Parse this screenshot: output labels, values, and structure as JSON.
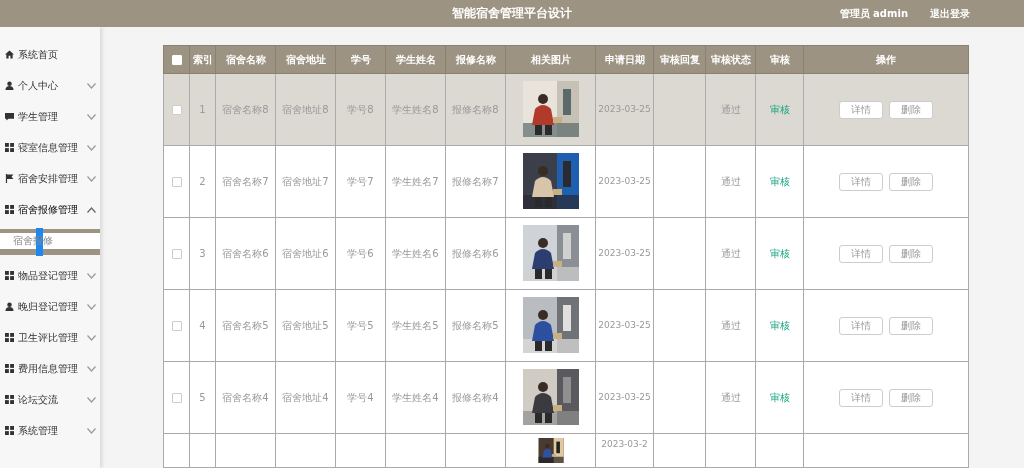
{
  "header": {
    "title": "智能宿舍管理平台设计",
    "user": "管理员 admin",
    "logout": "退出登录"
  },
  "sidebar": {
    "items": [
      {
        "label": "系统首页"
      },
      {
        "label": "个人中心",
        "expanded": false
      },
      {
        "label": "学生管理",
        "expanded": false
      },
      {
        "label": "寝室信息管理",
        "expanded": false
      },
      {
        "label": "宿舍安排管理",
        "expanded": false
      },
      {
        "label": "宿舍报修管理",
        "expanded": true,
        "children": [
          {
            "label": "宿舍报修",
            "selected": true
          }
        ]
      },
      {
        "label": "物品登记管理",
        "expanded": false
      },
      {
        "label": "晚归登记管理",
        "expanded": false
      },
      {
        "label": "卫生评比管理",
        "expanded": false
      },
      {
        "label": "费用信息管理",
        "expanded": false
      },
      {
        "label": "论坛交流",
        "expanded": false
      },
      {
        "label": "系统管理",
        "expanded": false
      }
    ]
  },
  "table": {
    "select_all_checked": false,
    "columns": [
      "索引",
      "宿舍名称",
      "宿舍地址",
      "学号",
      "学生姓名",
      "报修名称",
      "相关图片",
      "申请日期",
      "审核回复",
      "审核状态",
      "审核",
      "操作"
    ],
    "rows": [
      {
        "kind": "full",
        "highlighted": true,
        "checked": false,
        "index": "1",
        "dorm_name": "宿舍名称8",
        "dorm_address": "宿舍地址8",
        "student_id": "学号8",
        "student_name": "学生姓名8",
        "repair_name": "报修名称8",
        "date": "2023-03-25",
        "status": "通过",
        "review": "审核",
        "actions": [
          "详情",
          "删除"
        ]
      },
      {
        "kind": "full",
        "highlighted": false,
        "checked": false,
        "index": "2",
        "dorm_name": "宿舍名称7",
        "dorm_address": "宿舍地址7",
        "student_id": "学号7",
        "student_name": "学生姓名7",
        "repair_name": "报修名称7",
        "date": "2023-03-25",
        "status": "通过",
        "review": "审核",
        "actions": [
          "详情",
          "删除"
        ]
      },
      {
        "kind": "full",
        "highlighted": false,
        "checked": false,
        "index": "3",
        "dorm_name": "宿舍名称6",
        "dorm_address": "宿舍地址6",
        "student_id": "学号6",
        "student_name": "学生姓名6",
        "repair_name": "报修名称6",
        "date": "2023-03-25",
        "status": "通过",
        "review": "审核",
        "actions": [
          "详情",
          "删除"
        ]
      },
      {
        "kind": "full",
        "highlighted": false,
        "checked": false,
        "index": "4",
        "dorm_name": "宿舍名称5",
        "dorm_address": "宿舍地址5",
        "student_id": "学号5",
        "student_name": "学生姓名5",
        "repair_name": "报修名称5",
        "date": "2023-03-25",
        "status": "通过",
        "review": "审核",
        "actions": [
          "详情",
          "删除"
        ]
      },
      {
        "kind": "full",
        "highlighted": false,
        "checked": false,
        "index": "5",
        "dorm_name": "宿舍名称4",
        "dorm_address": "宿舍地址4",
        "student_id": "学号4",
        "student_name": "学生姓名4",
        "repair_name": "报修名称4",
        "date": "2023-03-25",
        "status": "通过",
        "review": "审核",
        "actions": [
          "详情",
          "删除"
        ]
      },
      {
        "kind": "partial",
        "highlighted": false,
        "date": "2023-03-2"
      }
    ]
  }
}
